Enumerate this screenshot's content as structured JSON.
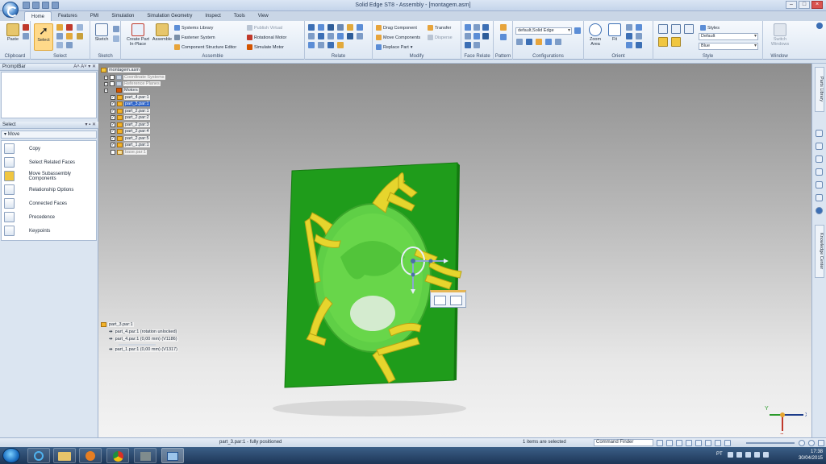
{
  "window": {
    "title": "Solid Edge ST8 - Assembly - [montagem.asm]"
  },
  "menu_tabs": [
    "Home",
    "Features",
    "PMI",
    "Simulation",
    "Simulation Geometry",
    "Inspect",
    "Tools",
    "View"
  ],
  "ribbon": {
    "groups": {
      "clipboard": "Clipboard",
      "select": "Select",
      "sketch": "Sketch",
      "assemble": "Assemble",
      "relate": "Relate",
      "modify": "Modify",
      "face_relate": "Face Relate",
      "pattern": "Pattern",
      "configurations": "Configurations",
      "orient": "Orient",
      "style": "Style",
      "window": "Window"
    },
    "buttons": {
      "paste": "Paste",
      "select": "Select",
      "sketch": "Sketch",
      "create_part": "Create Part In-Place",
      "assemble": "Assemble",
      "systems_library": "Systems Library",
      "fastener_system": "Fastener System",
      "component_structure_editor": "Component Structure Editor",
      "publish_virtual": "Publish Virtual",
      "rotational_motor": "Rotational Motor",
      "simulate_motor": "Simulate Motor",
      "drag_component": "Drag Component",
      "move_components": "Move Components",
      "replace_part": "Replace Part",
      "transfer": "Transfer",
      "disperse": "Disperse",
      "zoom_area": "Zoom Area",
      "fit": "Fit",
      "styles": "Styles",
      "switch_windows": "Switch Windows"
    },
    "configuration_value": "default,Solid Edge",
    "style_value_1": "Default",
    "style_value_2": "Blue"
  },
  "promptbar": {
    "title": "PromptBar"
  },
  "select_panel": {
    "title": "Select",
    "command": "Move",
    "options": [
      "Copy",
      "Select Related Faces",
      "Move Subassembly Components",
      "Relationship Options",
      "Connected Faces",
      "Precedence",
      "Keypoints"
    ]
  },
  "tree": {
    "root": "montagem.asm",
    "items": [
      {
        "label": "Coordinate Systems"
      },
      {
        "label": "Reference Planes"
      },
      {
        "label": "Motors"
      },
      {
        "label": "part_4.par:1"
      },
      {
        "label": "part_3.par:1"
      },
      {
        "label": "part_2.par:1"
      },
      {
        "label": "part_2.par:2"
      },
      {
        "label": "part_2.par:3"
      },
      {
        "label": "part_2.par:4"
      },
      {
        "label": "part_2.par:5"
      },
      {
        "label": "part_1.par:1"
      },
      {
        "label": "base.par:1"
      }
    ]
  },
  "relationships": {
    "title": "part_3.par:1",
    "rows": [
      "part_4.par:1  (rotation unlocked)",
      "part_4.par:1  (0,00 mm)  (V1186)",
      "part_1.par:1  (0,00 mm)  (V1317)"
    ]
  },
  "right_tabs": {
    "parts_library": "Parts Library",
    "knowledge_center": "Knowledge Center"
  },
  "statusbar": {
    "message": "part_3.par:1 - fully positioned",
    "selection": "1 items are selected",
    "command_finder": "Command Finder"
  },
  "triad": {
    "x": "X",
    "y": "Y",
    "z": "Z"
  },
  "taskbar": {
    "language": "PT",
    "time": "17:38",
    "date": "30/04/2015"
  },
  "colors": {
    "plate": "#1e9a1a",
    "part_yellow": "#e6d52d",
    "disc_green": "#6cd94c",
    "ribbon_bg": "#e8eef7",
    "select_highlight": "#ffd98a"
  }
}
